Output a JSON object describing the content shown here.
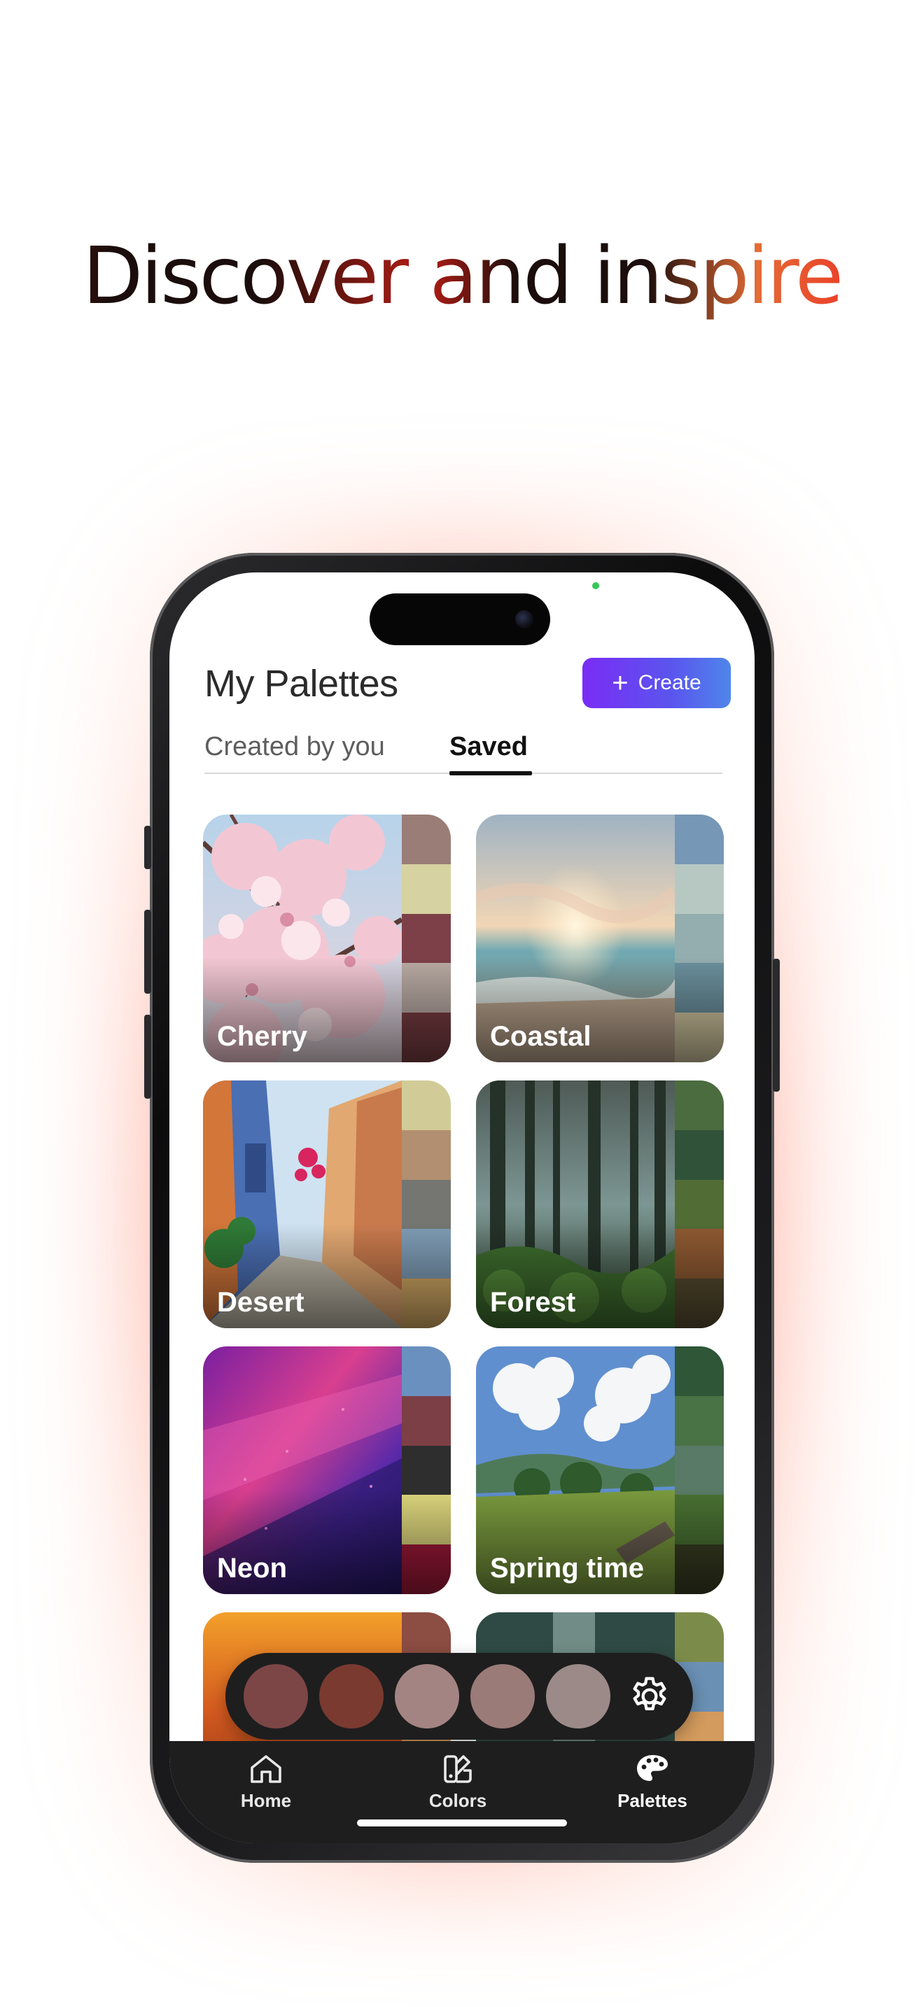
{
  "headline": "Discover and inspire",
  "screen": {
    "title": "My Palettes",
    "create_label": "Create",
    "tabs": [
      {
        "label": "Created by you",
        "active": false
      },
      {
        "label": "Saved",
        "active": true
      }
    ],
    "accent_gradient": [
      "#7a2cf5",
      "#4f86ea"
    ],
    "palettes": [
      {
        "name": "Cherry",
        "swatches": [
          "#9b7d77",
          "#d7d2a1",
          "#7d4048",
          "#b9aaa3",
          "#7b3f44"
        ]
      },
      {
        "name": "Coastal",
        "swatches": [
          "#7797b6",
          "#b7c8c3",
          "#94aeb0",
          "#6b909d",
          "#d4c9a2"
        ]
      },
      {
        "name": "Desert",
        "swatches": [
          "#d1cc97",
          "#b28f70",
          "#757671",
          "#7f9db6",
          "#d9ae67"
        ]
      },
      {
        "name": "Forest",
        "swatches": [
          "#4b6c3e",
          "#2f5238",
          "#516c35",
          "#8f5a32",
          "#574d30"
        ]
      },
      {
        "name": "Neon",
        "swatches": [
          "#6a90c0",
          "#7c3f45",
          "#2e2e2e",
          "#dcd57c",
          "#a3193a"
        ]
      },
      {
        "name": "Spring time",
        "swatches": [
          "#2e5637",
          "#4a7345",
          "#587a66",
          "#497132",
          "#3a3f22"
        ]
      },
      {
        "name": "",
        "swatches": [
          "#8c4d42",
          "#d9be73",
          "#d39b5d",
          "#b77a49",
          "#d9be73"
        ]
      },
      {
        "name": "",
        "swatches": [
          "#7b8c4a",
          "#6a90b4",
          "#d39b5d",
          "#6a90b4",
          "#d39b5d"
        ]
      }
    ],
    "selected_colors": [
      "#7d4646",
      "#7a3a30",
      "#a48482",
      "#9b7b78",
      "#9c8a88"
    ],
    "settings_icon": "gear-icon"
  },
  "tabbar": {
    "items": [
      {
        "label": "Home",
        "icon": "home-icon"
      },
      {
        "label": "Colors",
        "icon": "swatch-book-icon"
      },
      {
        "label": "Palettes",
        "icon": "palette-icon"
      }
    ]
  }
}
